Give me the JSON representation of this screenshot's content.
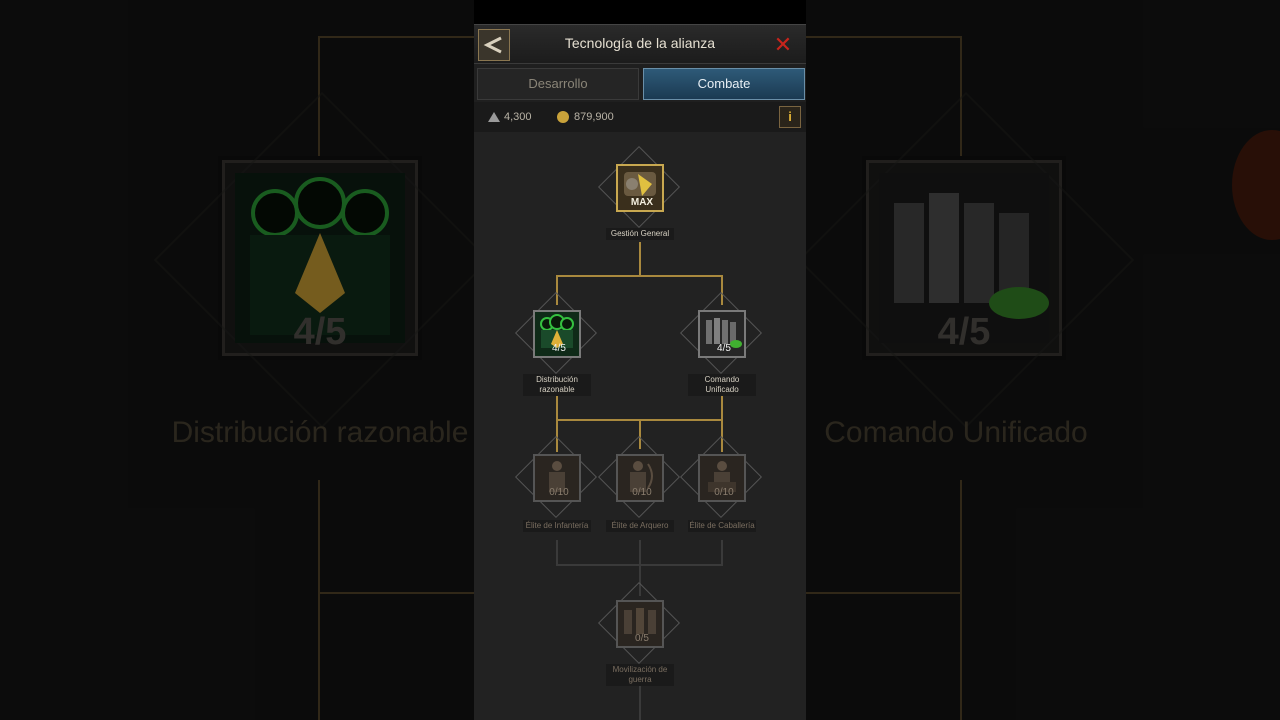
{
  "header": {
    "title": "Tecnología de la alianza"
  },
  "tabs": [
    {
      "label": "Desarrollo",
      "active": false
    },
    {
      "label": "Combate",
      "active": true
    }
  ],
  "resources": {
    "honor": "4,300",
    "contribution": "879,900"
  },
  "nodes": {
    "gestion": {
      "label": "Gestión General",
      "count": "MAX"
    },
    "distribucion": {
      "label": "Distribución razonable",
      "count": "4/5"
    },
    "comando": {
      "label": "Comando Unificado",
      "count": "4/5"
    },
    "infanteria": {
      "label": "Élite de Infantería",
      "count": "0/10"
    },
    "arquero": {
      "label": "Élite de Arquero",
      "count": "0/10"
    },
    "caballeria": {
      "label": "Élite de Caballería",
      "count": "0/10"
    },
    "movilizacion": {
      "label": "Movilización de guerra",
      "count": "0/5"
    }
  },
  "background": {
    "left_label": "Distribución razonable",
    "left_count": "4/5",
    "right_label": "Comando Unificado",
    "right_count": "4/5"
  },
  "colors": {
    "accent_gold": "#a9893e",
    "tab_active": "#2e5a78",
    "close_red": "#c8241c"
  }
}
